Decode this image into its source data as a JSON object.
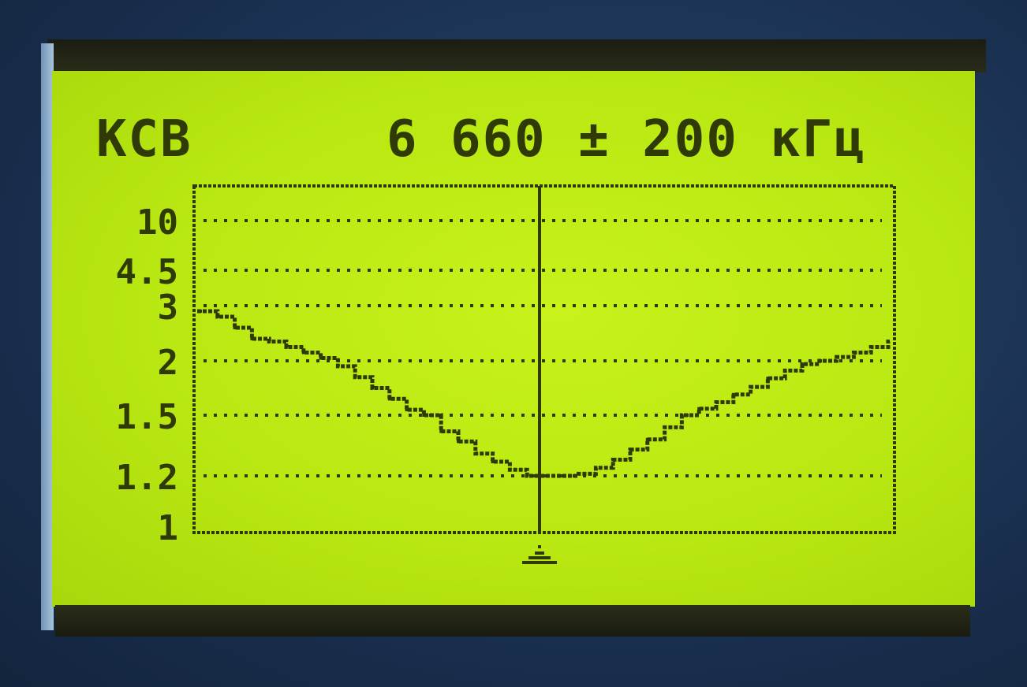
{
  "display": {
    "mode_label": "КСВ",
    "frequency_label": "6 660 ± 200 кГц"
  },
  "chart_data": {
    "type": "line",
    "yscale": "swr",
    "ylim": [
      1,
      10
    ],
    "xlim": [
      -200,
      200
    ],
    "center_marker": true,
    "yticks": [
      "10",
      "4.5",
      "3",
      "2",
      "1.5",
      "1.2",
      "1"
    ],
    "x": [
      -200,
      -190,
      -180,
      -170,
      -160,
      -150,
      -140,
      -130,
      -120,
      -110,
      -100,
      -90,
      -80,
      -70,
      -60,
      -50,
      -40,
      -30,
      -20,
      -10,
      0,
      10,
      20,
      30,
      40,
      50,
      60,
      70,
      80,
      90,
      100,
      110,
      120,
      130,
      140,
      150,
      160,
      170,
      180,
      190,
      200
    ],
    "y": [
      2.9,
      2.8,
      2.6,
      2.4,
      2.35,
      2.25,
      2.15,
      2.05,
      1.95,
      1.85,
      1.75,
      1.65,
      1.55,
      1.5,
      1.42,
      1.37,
      1.31,
      1.27,
      1.23,
      1.2,
      1.2,
      1.2,
      1.21,
      1.24,
      1.28,
      1.33,
      1.38,
      1.44,
      1.5,
      1.56,
      1.62,
      1.69,
      1.76,
      1.84,
      1.91,
      1.97,
      2.0,
      2.07,
      2.15,
      2.25,
      2.35
    ],
    "color": "#2f3a06"
  }
}
